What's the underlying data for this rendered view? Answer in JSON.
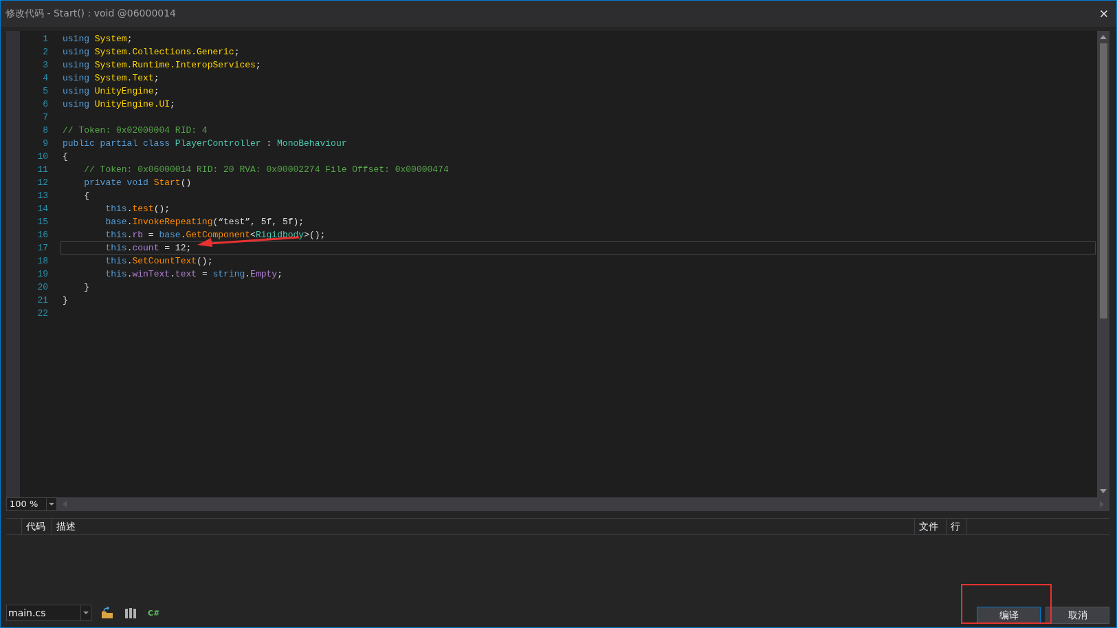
{
  "window": {
    "title": "修改代码 - Start() : void @06000014"
  },
  "editor": {
    "lines": [
      {
        "number": "1",
        "current": false,
        "tokens": [
          {
            "kind": "keyword",
            "text": "using"
          },
          {
            "kind": "namespace",
            "text": " System"
          },
          {
            "kind": "plain",
            "text": ";"
          }
        ]
      },
      {
        "number": "2",
        "current": false,
        "tokens": [
          {
            "kind": "keyword",
            "text": "using"
          },
          {
            "kind": "namespace",
            "text": " System.Collections.Generic"
          },
          {
            "kind": "plain",
            "text": ";"
          }
        ]
      },
      {
        "number": "3",
        "current": false,
        "tokens": [
          {
            "kind": "keyword",
            "text": "using"
          },
          {
            "kind": "namespace",
            "text": " System.Runtime.InteropServices"
          },
          {
            "kind": "plain",
            "text": ";"
          }
        ]
      },
      {
        "number": "4",
        "current": false,
        "tokens": [
          {
            "kind": "keyword",
            "text": "using"
          },
          {
            "kind": "namespace",
            "text": " System.Text"
          },
          {
            "kind": "plain",
            "text": ";"
          }
        ]
      },
      {
        "number": "5",
        "current": false,
        "tokens": [
          {
            "kind": "keyword",
            "text": "using"
          },
          {
            "kind": "namespace",
            "text": " UnityEngine"
          },
          {
            "kind": "plain",
            "text": ";"
          }
        ]
      },
      {
        "number": "6",
        "current": false,
        "tokens": [
          {
            "kind": "keyword",
            "text": "using"
          },
          {
            "kind": "namespace",
            "text": " UnityEngine.UI"
          },
          {
            "kind": "plain",
            "text": ";"
          }
        ]
      },
      {
        "number": "7",
        "current": false
      },
      {
        "number": "8",
        "current": false,
        "tokens": [
          {
            "kind": "comment",
            "text": "// Token: 0x02000004 RID: 4"
          }
        ]
      },
      {
        "number": "9",
        "current": false,
        "tokens": [
          {
            "kind": "keyword",
            "text": "public partial class"
          },
          {
            "kind": "type",
            "text": " PlayerController"
          },
          {
            "kind": "plain",
            "text": " : "
          },
          {
            "kind": "type",
            "text": "MonoBehaviour"
          }
        ]
      },
      {
        "number": "10",
        "current": false,
        "tokens": [
          {
            "kind": "plain",
            "text": "{"
          }
        ]
      },
      {
        "number": "11",
        "current": false,
        "tokens": [
          {
            "kind": "comment",
            "text": "    // Token: 0x06000014 RID: 20 RVA: 0x00002274 File Offset: 0x00000474"
          }
        ]
      },
      {
        "number": "12",
        "current": false,
        "tokens": [
          {
            "kind": "keyword",
            "text": "    private void"
          },
          {
            "kind": "method",
            "text": " Start"
          },
          {
            "kind": "plain",
            "text": "()"
          }
        ]
      },
      {
        "number": "13",
        "current": false,
        "tokens": [
          {
            "kind": "plain",
            "text": "    {"
          }
        ]
      },
      {
        "number": "14",
        "current": false,
        "tokens": [
          {
            "kind": "keyword",
            "text": "        this"
          },
          {
            "kind": "plain",
            "text": "."
          },
          {
            "kind": "method",
            "text": "test"
          },
          {
            "kind": "plain",
            "text": "();"
          }
        ]
      },
      {
        "number": "15",
        "current": false,
        "tokens": [
          {
            "kind": "keyword",
            "text": "        base"
          },
          {
            "kind": "plain",
            "text": "."
          },
          {
            "kind": "method",
            "text": "InvokeRepeating"
          },
          {
            "kind": "plain",
            "text": "(“test”, 5f, 5f);"
          }
        ]
      },
      {
        "number": "16",
        "current": false,
        "tokens": [
          {
            "kind": "keyword",
            "text": "        this"
          },
          {
            "kind": "plain",
            "text": "."
          },
          {
            "kind": "field",
            "text": "rb"
          },
          {
            "kind": "plain",
            "text": " = "
          },
          {
            "kind": "keyword",
            "text": "base"
          },
          {
            "kind": "plain",
            "text": "."
          },
          {
            "kind": "method",
            "text": "GetComponent"
          },
          {
            "kind": "plain",
            "text": "<"
          },
          {
            "kind": "type",
            "text": "Rigidbody"
          },
          {
            "kind": "plain",
            "text": ">();"
          }
        ]
      },
      {
        "number": "17",
        "current": true,
        "tokens": [
          {
            "kind": "keyword",
            "text": "        this"
          },
          {
            "kind": "plain",
            "text": "."
          },
          {
            "kind": "field",
            "text": "count"
          },
          {
            "kind": "plain",
            "text": " = 12;"
          }
        ]
      },
      {
        "number": "18",
        "current": false,
        "tokens": [
          {
            "kind": "keyword",
            "text": "        this"
          },
          {
            "kind": "plain",
            "text": "."
          },
          {
            "kind": "method",
            "text": "SetCountText"
          },
          {
            "kind": "plain",
            "text": "();"
          }
        ]
      },
      {
        "number": "19",
        "current": false,
        "tokens": [
          {
            "kind": "keyword",
            "text": "        this"
          },
          {
            "kind": "plain",
            "text": "."
          },
          {
            "kind": "field",
            "text": "winText"
          },
          {
            "kind": "plain",
            "text": "."
          },
          {
            "kind": "field",
            "text": "text"
          },
          {
            "kind": "plain",
            "text": " = "
          },
          {
            "kind": "keyword",
            "text": "string"
          },
          {
            "kind": "plain",
            "text": "."
          },
          {
            "kind": "field",
            "text": "Empty"
          },
          {
            "kind": "plain",
            "text": ";"
          }
        ]
      },
      {
        "number": "20",
        "current": false,
        "tokens": [
          {
            "kind": "plain",
            "text": "    }"
          }
        ]
      },
      {
        "number": "21",
        "current": false,
        "tokens": [
          {
            "kind": "plain",
            "text": "}"
          }
        ]
      },
      {
        "number": "22",
        "current": false
      }
    ],
    "zoom": "100 %"
  },
  "error_list": {
    "columns": [
      "代码",
      "描述",
      "文件",
      "行"
    ]
  },
  "footer": {
    "file": "main.cs",
    "language": "C#",
    "buttons": [
      {
        "label": "编译",
        "default": true
      },
      {
        "label": "取消",
        "default": false
      }
    ]
  }
}
